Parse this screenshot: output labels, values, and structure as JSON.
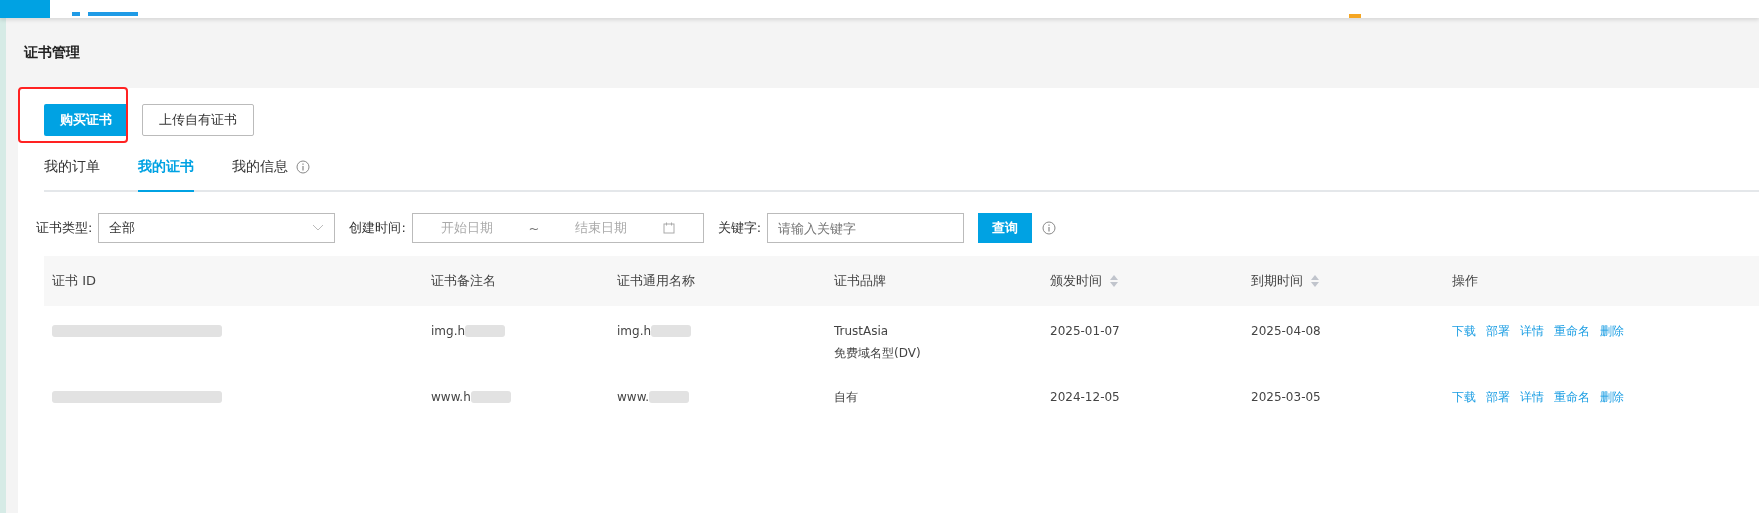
{
  "page_title": "证书管理",
  "toolbar": {
    "buttons": [
      {
        "label": "购买证书",
        "kind": "primary",
        "highlighted": true
      },
      {
        "label": "上传自有证书",
        "kind": "default",
        "highlighted": false
      }
    ]
  },
  "tabs": [
    {
      "label": "我的订单",
      "selected": false,
      "info": false
    },
    {
      "label": "我的证书",
      "selected": true,
      "info": false
    },
    {
      "label": "我的信息",
      "selected": false,
      "info": true
    }
  ],
  "filters": {
    "type_label": "证书类型:",
    "type_value": "全部",
    "time_label": "创建时间:",
    "start_placeholder": "开始日期",
    "range_separator": "~",
    "end_placeholder": "结束日期",
    "keyword_label": "关键字:",
    "keyword_placeholder": "请输入关键字",
    "query_button": "查询"
  },
  "table": {
    "columns": [
      {
        "label": "证书 ID",
        "sortable": false
      },
      {
        "label": "证书备注名",
        "sortable": false
      },
      {
        "label": "证书通用名称",
        "sortable": false
      },
      {
        "label": "证书品牌",
        "sortable": false
      },
      {
        "label": "颁发时间",
        "sortable": true
      },
      {
        "label": "到期时间",
        "sortable": true
      },
      {
        "label": "操作",
        "sortable": false
      }
    ],
    "rows": [
      {
        "cells": [
          {
            "redacted": true
          },
          {
            "text": "img.h",
            "redacted": true
          },
          {
            "text": "img.h",
            "redacted": true
          },
          {
            "text": "TrustAsia",
            "subtext": "免费域名型(DV)"
          },
          {
            "text": "2025-01-07"
          },
          {
            "text": "2025-04-08"
          }
        ],
        "actions": [
          "下载",
          "部署",
          "详情",
          "重命名",
          "删除"
        ]
      },
      {
        "cells": [
          {
            "redacted": true
          },
          {
            "text": "www.h",
            "redacted": true
          },
          {
            "text": "www.",
            "redacted": true
          },
          {
            "text": "自有"
          },
          {
            "text": "2024-12-05"
          },
          {
            "text": "2025-03-05"
          }
        ],
        "actions": [
          "下载",
          "部署",
          "详情",
          "重命名",
          "删除"
        ]
      }
    ]
  }
}
